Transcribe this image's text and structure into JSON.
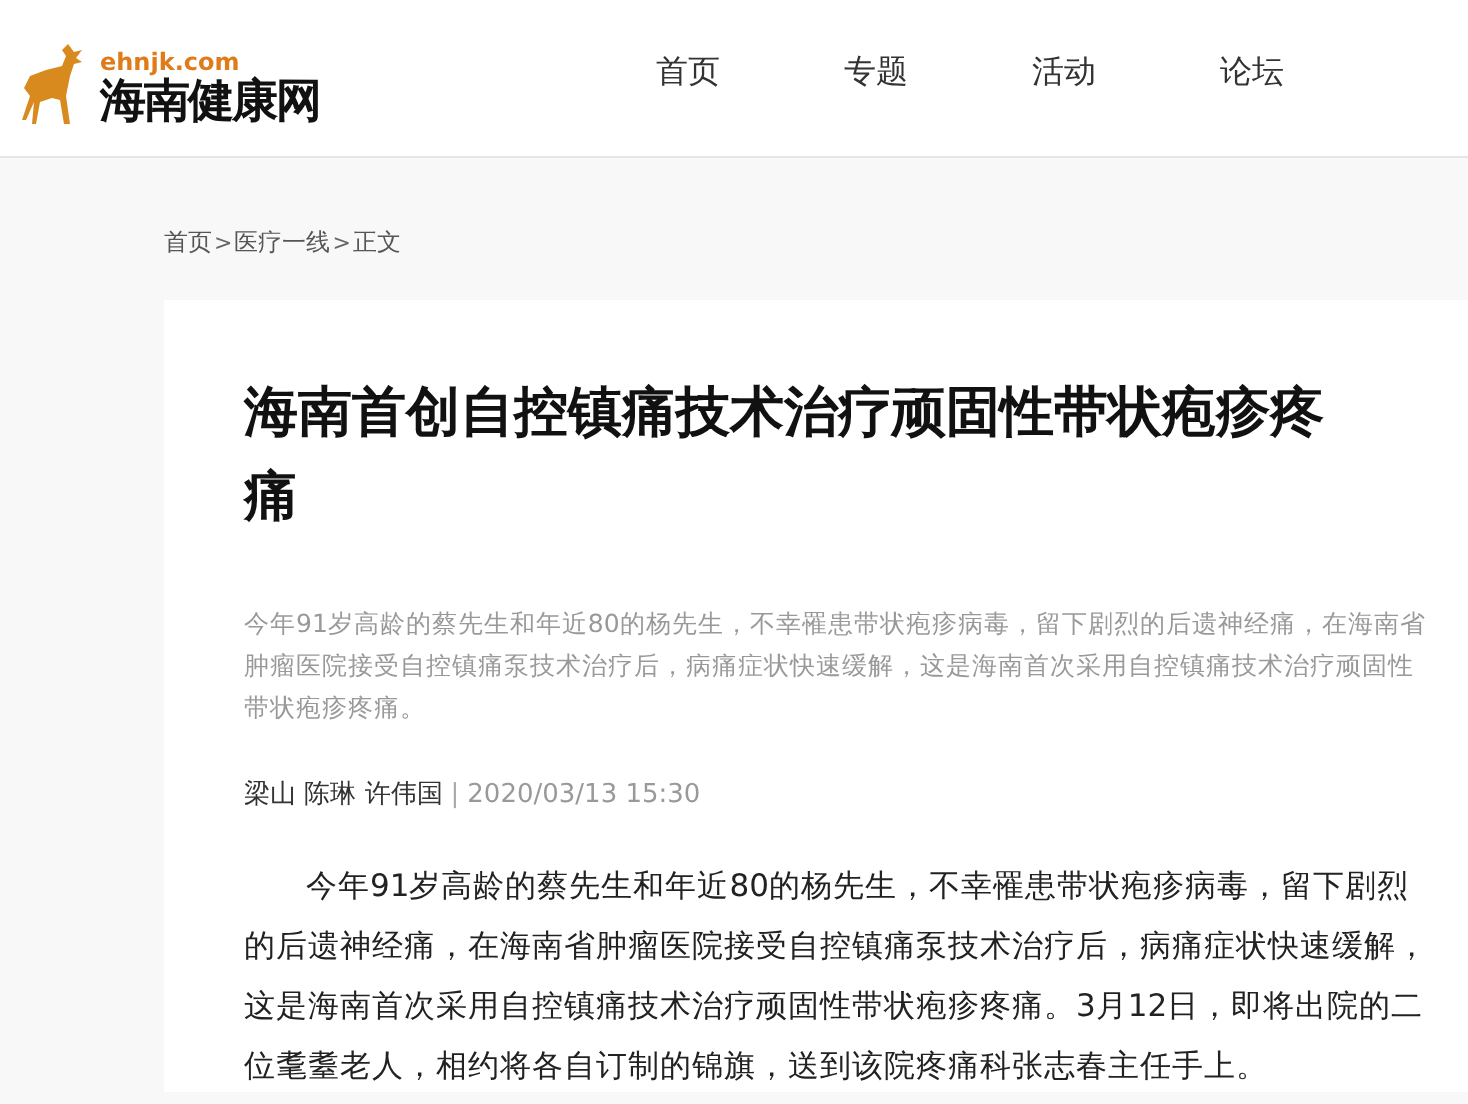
{
  "header": {
    "logo": {
      "domain": "ehnjk.com",
      "name": "海南健康网"
    },
    "nav": [
      {
        "label": "首页"
      },
      {
        "label": "专题"
      },
      {
        "label": "活动"
      },
      {
        "label": "论坛"
      }
    ]
  },
  "breadcrumb": {
    "separator": ">",
    "items": [
      "首页",
      "医疗一线",
      "正文"
    ]
  },
  "article": {
    "title": "海南首创自控镇痛技术治疗顽固性带状疱疹疼痛",
    "summary": "今年91岁高龄的蔡先生和年近80的杨先生，不幸罹患带状疱疹病毒，留下剧烈的后遗神经痛，在海南省肿瘤医院接受自控镇痛泵技术治疗后，病痛症状快速缓解，这是海南首次采用自控镇痛技术治疗顽固性带状疱疹疼痛。",
    "authors": "梁山 陈琳 许伟国",
    "divider": "|",
    "date": "2020/03/13 15:30",
    "paragraphs": [
      "今年91岁高龄的蔡先生和年近80的杨先生，不幸罹患带状疱疹病毒，留下剧烈的后遗神经痛，在海南省肿瘤医院接受自控镇痛泵技术治疗后，病痛症状快速缓解，这是海南首次采用自控镇痛技术治疗顽固性带状疱疹疼痛。3月12日，即将出院的二位耄耋老人，相约将各自订制的锦旗，送到该院疼痛科张志春主任手上。"
    ]
  }
}
